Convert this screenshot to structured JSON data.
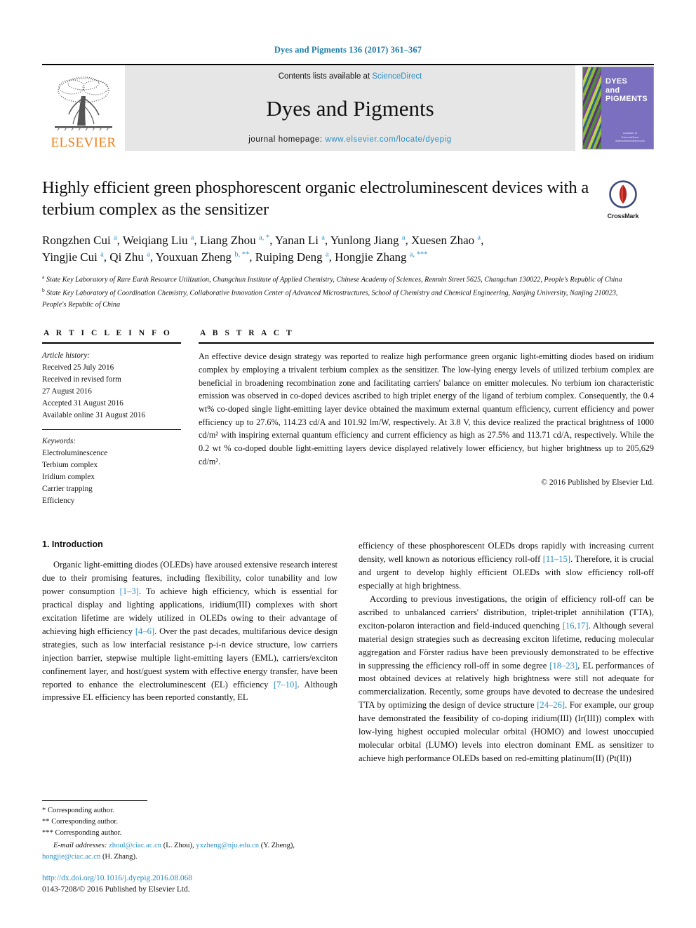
{
  "running_head": "Dyes and Pigments 136 (2017) 361–367",
  "masthead": {
    "contents_prefix": "Contents lists available at ",
    "sciencedirect": "ScienceDirect",
    "journal_title": "Dyes and Pigments",
    "homepage_prefix": "journal homepage: ",
    "homepage_url": "www.elsevier.com/locate/dyepig",
    "publisher": "ELSEVIER",
    "cover": {
      "line1": "DYES",
      "line2": "and",
      "line3": "PIGMENTS",
      "foot1": "available at",
      "foot2": "ScienceDirect",
      "foot3": "www.sciencedirect.com"
    },
    "accent_blue": "#2b8fc4",
    "elsevier_orange": "#F07F1A",
    "cover_purple": "#7b6fc0"
  },
  "article": {
    "title": "Highly efficient green phosphorescent organic electroluminescent devices with a terbium complex as the sensitizer",
    "crossmark_label": "CrossMark",
    "authors_line1": "Rongzhen Cui a, Weiqiang Liu a, Liang Zhou a, *, Yanan Li a, Yunlong Jiang a, Xuesen Zhao a,",
    "authors_line2": "Yingjie Cui a, Qi Zhu a, Youxuan Zheng b, **, Ruiping Deng a, Hongjie Zhang a, ***",
    "affiliation_a": "State Key Laboratory of Rare Earth Resource Utilization, Changchun Institute of Applied Chemistry, Chinese Academy of Sciences, Renmin Street 5625, Changchun 130022, People's Republic of China",
    "affiliation_b": "State Key Laboratory of Coordination Chemistry, Collaborative Innovation Center of Advanced Microstructures, School of Chemistry and Chemical Engineering, Nanjing University, Nanjing 210023, People's Republic of China"
  },
  "article_info": {
    "heading": "A R T I C L E  I N F O",
    "history_label": "Article history:",
    "history": [
      "Received 25 July 2016",
      "Received in revised form",
      "27 August 2016",
      "Accepted 31 August 2016",
      "Available online 31 August 2016"
    ],
    "keywords_label": "Keywords:",
    "keywords": [
      "Electroluminescence",
      "Terbium complex",
      "Iridium complex",
      "Carrier trapping",
      "Efficiency"
    ]
  },
  "abstract": {
    "heading": "A B S T R A C T",
    "text": "An effective device design strategy was reported to realize high performance green organic light-emitting diodes based on iridium complex by employing a trivalent terbium complex as the sensitizer. The low-lying energy levels of utilized terbium complex are beneficial in broadening recombination zone and facilitating carriers' balance on emitter molecules. No terbium ion characteristic emission was observed in co-doped devices ascribed to high triplet energy of the ligand of terbium complex. Consequently, the 0.4 wt% co-doped single light-emitting layer device obtained the maximum external quantum efficiency, current efficiency and power efficiency up to 27.6%, 114.23 cd/A and 101.92 lm/W, respectively. At 3.8 V, this device realized the practical brightness of 1000 cd/m² with inspiring external quantum efficiency and current efficiency as high as 27.5% and 113.71 cd/A, respectively. While the 0.2 wt % co-doped double light-emitting layers device displayed relatively lower efficiency, but higher brightness up to 205,629 cd/m².",
    "copyright": "© 2016 Published by Elsevier Ltd."
  },
  "introduction": {
    "heading": "1.  Introduction",
    "left_para1": "Organic light-emitting diodes (OLEDs) have aroused extensive research interest due to their promising features, including flexibility, color tunability and low power consumption [1–3]. To achieve high efficiency, which is essential for practical display and lighting applications, iridium(III) complexes with short excitation lifetime are widely utilized in OLEDs owing to their advantage of achieving high efficiency [4–6]. Over the past decades, multifarious device design strategies, such as low interfacial resistance p-i-n device structure, low carriers injection barrier, stepwise multiple light-emitting layers (EML), carriers/exciton confinement layer, and host/guest system with effective energy transfer, have been reported to enhance the electroluminescent (EL) efficiency [7–10]. Although impressive EL efficiency has been reported constantly, EL",
    "right_para1": "efficiency of these phosphorescent OLEDs drops rapidly with increasing current density, well known as notorious efficiency roll-off [11–15]. Therefore, it is crucial and urgent to develop highly efficient OLEDs with slow efficiency roll-off especially at high brightness.",
    "right_para2": "According to previous investigations, the origin of efficiency roll-off can be ascribed to unbalanced carriers' distribution, triplet-triplet annihilation (TTA), exciton-polaron interaction and field-induced quenching [16,17]. Although several material design strategies such as decreasing exciton lifetime, reducing molecular aggregation and Förster radius have been previously demonstrated to be effective in suppressing the efficiency roll-off in some degree [18–23], EL performances of most obtained devices at relatively high brightness were still not adequate for commercialization. Recently, some groups have devoted to decrease the undesired TTA by optimizing the design of device structure [24–26]. For example, our group have demonstrated the feasibility of co-doping iridium(III) (Ir(III)) complex with low-lying highest occupied molecular orbital (HOMO) and lowest unoccupied molecular orbital (LUMO) levels into electron dominant EML as sensitizer to achieve high performance OLEDs based on red-emitting platinum(II) (Pt(II))"
  },
  "footnotes": {
    "corr1": "* Corresponding author.",
    "corr2": "** Corresponding author.",
    "corr3": "*** Corresponding author.",
    "email_label": "E-mail addresses:",
    "email1": "zhoul@ciac.ac.cn",
    "email1_name": "(L. Zhou),",
    "email2": "yxzheng@nju.edu.cn",
    "email2_name": "(Y. Zheng),",
    "email3": "hongjie@ciac.ac.cn",
    "email3_name": "(H. Zhang).",
    "doi": "http://dx.doi.org/10.1016/j.dyepig.2016.08.068",
    "issn": "0143-7208/© 2016 Published by Elsevier Ltd."
  }
}
